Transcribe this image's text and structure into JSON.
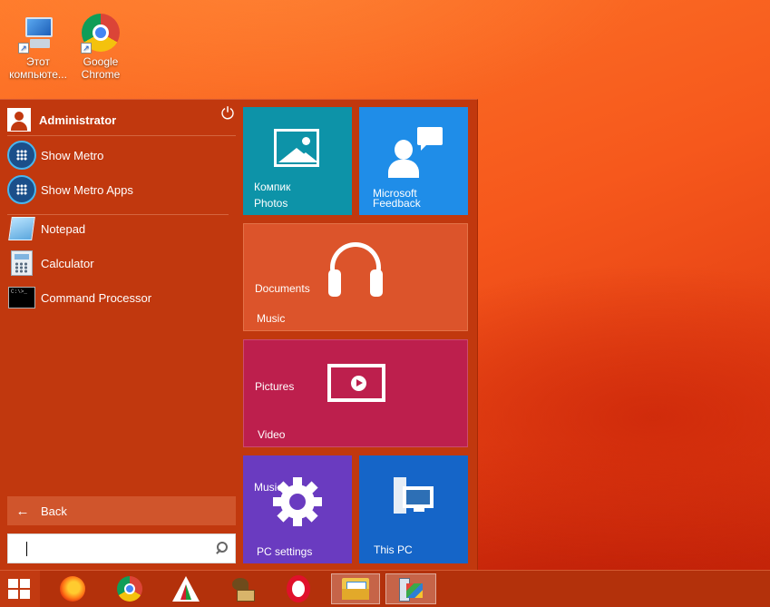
{
  "desktop": {
    "icons": [
      {
        "label": "Этот компьюте...",
        "icon": "computer-icon"
      },
      {
        "label": "Google Chrome",
        "icon": "chrome-icon"
      }
    ]
  },
  "start_menu": {
    "user": {
      "name": "Administrator",
      "icon": "user-icon"
    },
    "power_icon": "power-icon",
    "items": [
      {
        "label": "Show Metro",
        "icon": "metro-icon"
      },
      {
        "label": "Show Metro Apps",
        "icon": "metro-icon"
      },
      {
        "label": "Notepad",
        "icon": "notepad-icon"
      },
      {
        "label": "Calculator",
        "icon": "calculator-icon"
      },
      {
        "label": "Command Processor",
        "icon": "command-prompt-icon"
      }
    ],
    "cmd_icon_text": "C:\\>_",
    "back_label": "Back",
    "search": {
      "value": "",
      "placeholder": ""
    }
  },
  "tiles": {
    "photos": {
      "top": "Компик",
      "label": "Photos",
      "color": "#0d93a8"
    },
    "feedback": {
      "label_line1": "Microsoft",
      "label_line2": "Feedback",
      "color": "#1f8de8"
    },
    "music": {
      "top": "Documents",
      "label": "Music",
      "color": "#dc542b"
    },
    "video": {
      "top": "Pictures",
      "label": "Video",
      "color": "#bd1f4d"
    },
    "settings": {
      "top": "Music",
      "label": "PC settings",
      "color": "#6a3bc0"
    },
    "thispc": {
      "label": "This PC",
      "color": "#1565c8"
    }
  },
  "taskbar": {
    "items": [
      {
        "name": "start-button",
        "icon": "windows-logo-icon"
      },
      {
        "name": "firefox",
        "icon": "firefox-icon"
      },
      {
        "name": "chrome",
        "icon": "chrome-icon"
      },
      {
        "name": "app-triangle",
        "icon": "red-green-triangle-icon"
      },
      {
        "name": "gramophone",
        "icon": "gramophone-icon"
      },
      {
        "name": "opera",
        "icon": "opera-icon"
      },
      {
        "name": "file-explorer",
        "icon": "folder-icon",
        "active": true
      },
      {
        "name": "system-app",
        "icon": "pc-icon",
        "active": true
      }
    ]
  }
}
